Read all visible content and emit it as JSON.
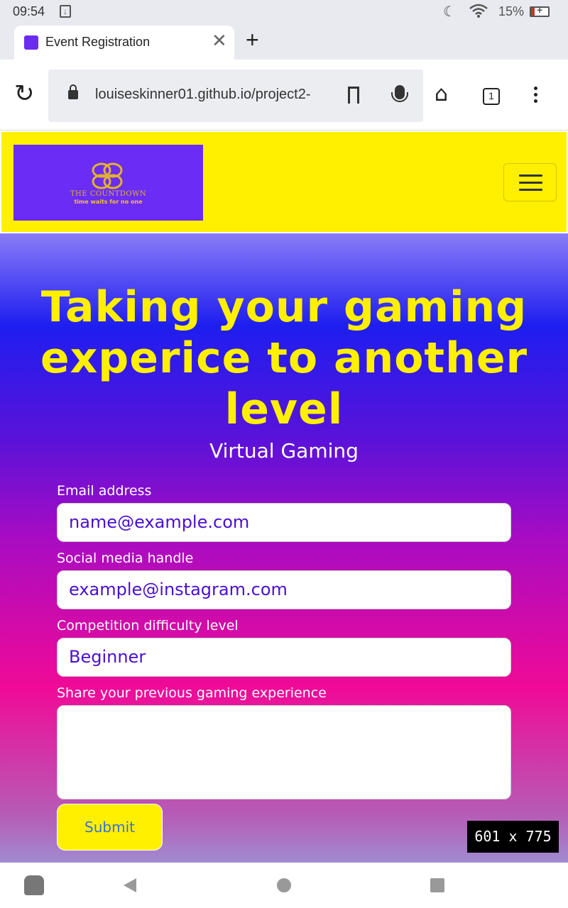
{
  "status_bar": {
    "time": "09:54",
    "battery": "15%"
  },
  "browser": {
    "tab_title": "Event Registration",
    "url": "louiseskinner01.github.io/project2-",
    "tab_count": "1"
  },
  "site": {
    "logo": {
      "title": "THE COUNTDOWN",
      "tagline": "time waits for no one"
    },
    "hero_title": "Taking your gaming experice to another level",
    "hero_subtitle": "Virtual Gaming",
    "form": {
      "email_label": "Email address",
      "email_placeholder": "name@example.com",
      "social_label": "Social media handle",
      "social_placeholder": "example@instagram.com",
      "difficulty_label": "Competition difficulty level",
      "difficulty_value": "Beginner",
      "experience_label": "Share your previous gaming experience",
      "experience_value": "",
      "submit_label": "Submit"
    }
  },
  "overlay": {
    "dimensions": "601 x 775"
  },
  "colors": {
    "nav_bg": "#fff000",
    "accent_yellow": "#fff000",
    "logo_bg": "#6b2cf5",
    "field_text": "#4a0fd0"
  }
}
